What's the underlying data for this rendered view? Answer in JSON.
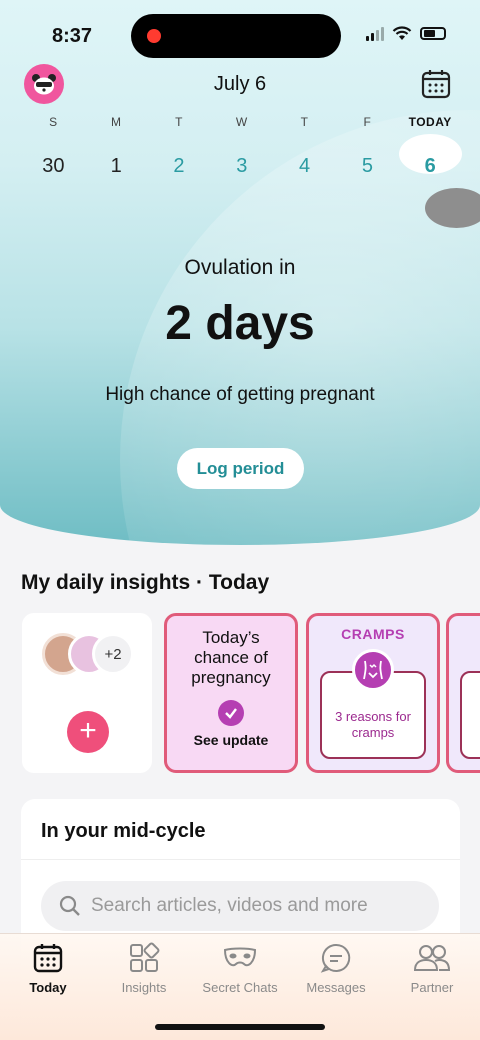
{
  "status": {
    "time": "8:37"
  },
  "header": {
    "month_title": "July 6"
  },
  "week": {
    "labels": [
      "S",
      "M",
      "T",
      "W",
      "T",
      "F",
      "TODAY"
    ],
    "days": [
      "30",
      "1",
      "2",
      "3",
      "4",
      "5",
      "6"
    ]
  },
  "hero": {
    "label": "Ovulation in",
    "days": "2 days",
    "subtitle": "High chance of getting pregnant",
    "log_button": "Log period"
  },
  "insights": {
    "title": "My daily insights · Today",
    "people_count": "+2",
    "add_label": "+",
    "pregnancy_card": {
      "text": "Today’s chance of pregnancy",
      "action": "See update"
    },
    "cramps_card": {
      "title": "CRAMPS",
      "text": "3 reasons for cramps"
    }
  },
  "midcycle": {
    "title": "In your mid-cycle",
    "search_placeholder": "Search articles, videos and more"
  },
  "tabs": [
    {
      "label": "Today",
      "icon": "calendar-icon",
      "active": true
    },
    {
      "label": "Insights",
      "icon": "grid-icon"
    },
    {
      "label": "Secret Chats",
      "icon": "mask-icon"
    },
    {
      "label": "Messages",
      "icon": "chat-icon"
    },
    {
      "label": "Partner",
      "icon": "partner-icon"
    }
  ],
  "colors": {
    "teal": "#2a9ba2",
    "pink": "#ef4f7b",
    "purple": "#b53fb2",
    "card_border": "#e05b7a"
  }
}
